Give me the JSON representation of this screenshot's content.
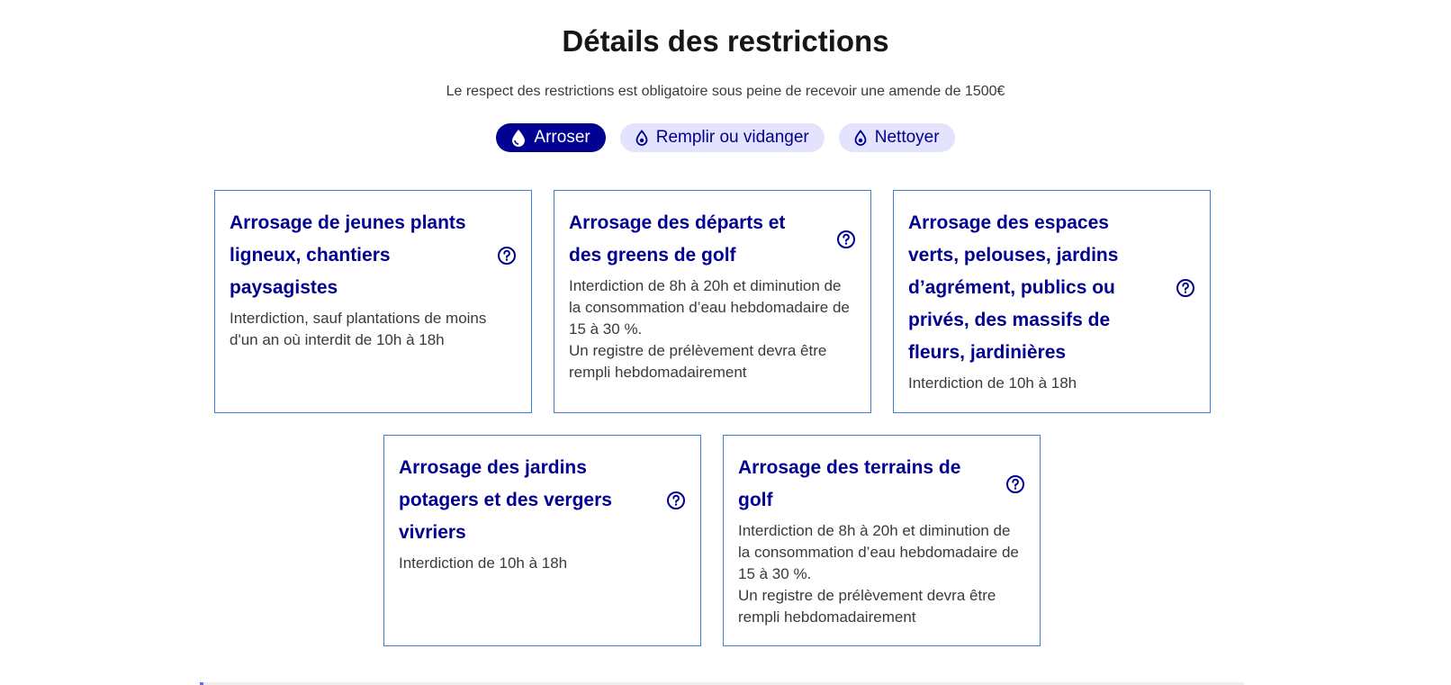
{
  "header": {
    "title": "Détails des restrictions",
    "subtitle": "Le respect des restrictions est obligatoire sous peine de recevoir une amende de 1500€"
  },
  "tabs": [
    {
      "label": "Arroser",
      "icon": "water-drop-icon",
      "active": true
    },
    {
      "label": "Remplir ou vidanger",
      "icon": "flame-drop-icon",
      "active": false
    },
    {
      "label": "Nettoyer",
      "icon": "flame-drop-icon",
      "active": false
    }
  ],
  "cards": [
    {
      "title": "Arrosage de jeunes plants ligneux, chantiers paysagistes",
      "text": "Interdiction, sauf plantations de moins d'un an où interdit de 10h à 18h"
    },
    {
      "title": "Arrosage des départs et des greens de golf",
      "text": "Interdiction de 8h à 20h et diminution de la consommation d’eau hebdomadaire de 15 à 30 %.\nUn registre de prélèvement devra être rempli hebdomadairement"
    },
    {
      "title": "Arrosage des espaces verts, pelouses, jardins d’agrément, publics ou privés, des massifs de fleurs, jardinières",
      "text": "Interdiction de 10h à 18h"
    },
    {
      "title": "Arrosage des jardins potagers et des vergers vivriers",
      "text": "Interdiction de 10h à 18h"
    },
    {
      "title": "Arrosage des terrains de golf",
      "text": "Interdiction de 8h à 20h et diminution de la consommation d’eau hebdomadaire de 15 à 30 %.\nUn registre de prélèvement devra être rempli hebdomadairement"
    }
  ],
  "colors": {
    "primary": "#000091",
    "tab_inactive_bg": "#e3e3fd",
    "card_border": "#3d7fd9",
    "text": "#3a3a3a"
  }
}
